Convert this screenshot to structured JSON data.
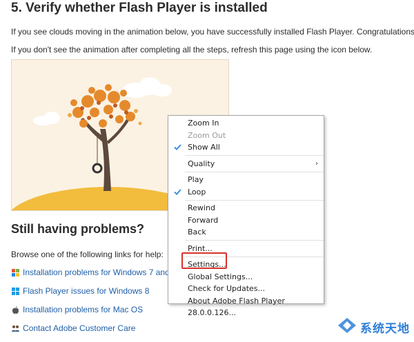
{
  "section": {
    "heading": "5. Verify whether Flash Player is installed",
    "paragraph_1": "If you see clouds moving in the animation below, you have successfully installed Flash Player. Congratulations!",
    "paragraph_2": "If you don't see the animation after completing all the steps, refresh this page using the icon below."
  },
  "help": {
    "heading": "Still having problems?",
    "intro": "Browse one of the following links for help:",
    "links": [
      {
        "label": "Installation problems for Windows 7 and c",
        "icon": "windows-7-flag-icon"
      },
      {
        "label": "Flash Player issues for Windows 8",
        "icon": "windows-8-logo-icon"
      },
      {
        "label": "Installation problems for Mac OS",
        "icon": "apple-logo-icon"
      },
      {
        "label": "Contact Adobe Customer Care",
        "icon": "people-icon"
      }
    ]
  },
  "context_menu": {
    "items": [
      {
        "label": "Zoom In",
        "enabled": true,
        "checked": false
      },
      {
        "label": "Zoom Out",
        "enabled": false,
        "checked": false
      },
      {
        "label": "Show All",
        "enabled": true,
        "checked": true
      },
      {
        "separator": true
      },
      {
        "label": "Quality",
        "enabled": true,
        "checked": false,
        "submenu": true
      },
      {
        "separator": true
      },
      {
        "label": "Play",
        "enabled": true,
        "checked": false
      },
      {
        "label": "Loop",
        "enabled": true,
        "checked": true
      },
      {
        "separator": true
      },
      {
        "label": "Rewind",
        "enabled": true,
        "checked": false
      },
      {
        "label": "Forward",
        "enabled": true,
        "checked": false
      },
      {
        "label": "Back",
        "enabled": true,
        "checked": false
      },
      {
        "separator": true
      },
      {
        "label": "Print...",
        "enabled": true,
        "checked": false
      },
      {
        "separator": true
      },
      {
        "label": "Settings...",
        "enabled": true,
        "checked": false,
        "highlighted": true
      },
      {
        "label": "Global Settings...",
        "enabled": true,
        "checked": false
      },
      {
        "label": "Check for Updates...",
        "enabled": true,
        "checked": false
      },
      {
        "label": "About Adobe Flash Player 28.0.0.126...",
        "enabled": true,
        "checked": false
      }
    ],
    "highlight_color": "#d6322b",
    "check_color": "#3a8ee6"
  },
  "watermark": {
    "text": "系统天地",
    "color": "#2f7fd8"
  },
  "colors": {
    "link": "#1f5fa8",
    "animation_bg": "#fbf2e3",
    "sun": "#f5b731",
    "cloud": "#ffffff",
    "tree_trunk": "#5d4a3c",
    "leaves": "#e58a2c"
  }
}
